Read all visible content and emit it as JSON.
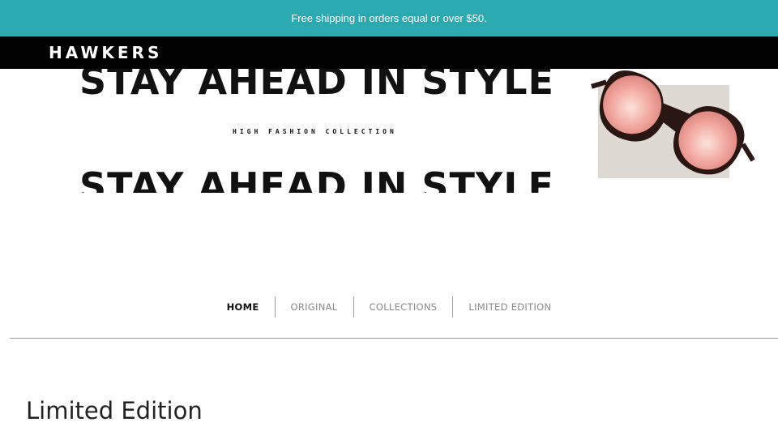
{
  "promo": {
    "text": "Free shipping in orders equal or over $50."
  },
  "header": {
    "logo": "HAWKERS"
  },
  "hero": {
    "headline": "STAY AHEAD IN STYLE",
    "subheading": "HIGH FASHION COLLECTION"
  },
  "nav": {
    "items": [
      {
        "label": "HOME",
        "active": true
      },
      {
        "label": "ORIGINAL",
        "active": false
      },
      {
        "label": "COLLECTIONS",
        "active": false
      },
      {
        "label": "LIMITED EDITION",
        "active": false
      }
    ]
  },
  "section": {
    "title": "Limited Edition"
  },
  "colors": {
    "promo_bg": "#2aaab0",
    "header_bg": "#000000",
    "lens": "#f0a09a",
    "frame": "#2a1612"
  }
}
